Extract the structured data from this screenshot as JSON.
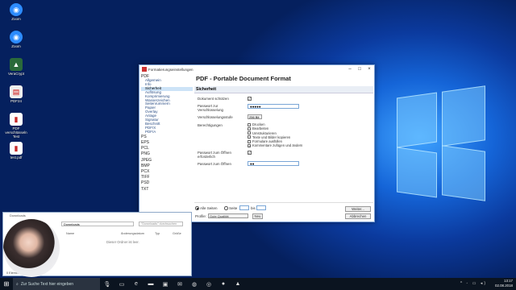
{
  "desktop": {
    "icons": [
      {
        "label": "Zoom",
        "glyph": "◉",
        "color": "#2d8cff",
        "icon": "zoom-icon"
      },
      {
        "label": "Zoom",
        "glyph": "◉",
        "color": "#2d8cff",
        "icon": "zoom-icon"
      },
      {
        "label": "VeraCrypt",
        "glyph": "▲",
        "color": "#2a6a3a",
        "icon": "veracrypt-icon"
      },
      {
        "label": "PDF24",
        "glyph": "▤",
        "color": "#eeeeee",
        "icon": "pdf24-icon"
      },
      {
        "label": "PDF verschlüsseln Test",
        "glyph": "▮",
        "color": "#c62828",
        "icon": "pdf-file-icon"
      },
      {
        "label": "test.pdf",
        "glyph": "▮",
        "color": "#c62828",
        "icon": "pdf-file-icon"
      }
    ]
  },
  "dialog": {
    "title": "Formatierungseinstellungen",
    "heading": "PDF - Portable Document Format",
    "section": "Sicherheit",
    "nav_pdf": "PDF",
    "nav_pdf_sub": [
      "Allgemein",
      "Info",
      "Sicherheit",
      "Auflösung",
      "Komprimierung",
      "Wasserzeichen",
      "Seitenrummern",
      "Papier",
      "Overlay",
      "Anlage",
      "Signatur",
      "Beschnitt",
      "PDF/X",
      "PDF/A"
    ],
    "nav_formats": [
      "PS",
      "EPS",
      "PCL",
      "PNG",
      "JPEG",
      "BMP",
      "PCX",
      "TIFF",
      "PSD",
      "TXT"
    ],
    "fields": {
      "protect_label": "Dokument schützen",
      "protect_checked": "✓",
      "pw_label": "Passwort zur Verschlüsselung",
      "pw_value": "●●●●●",
      "strength_label": "Verschlüsselungsstufe",
      "strength_value": "256 Bit",
      "perms_label": "Berechtigungen",
      "open_req_label": "Passwort zum Öffnen erforderlich",
      "open_req_checked": "✓",
      "open_pw_label": "Passwort zum Öffnen",
      "open_pw_value": "●●"
    },
    "permissions": [
      {
        "label": "Drucken",
        "checked": ""
      },
      {
        "label": "Bearbeiten",
        "checked": ""
      },
      {
        "label": "Umstrukturieren",
        "checked": ""
      },
      {
        "label": "Texte und Bilder kopieren",
        "checked": ""
      },
      {
        "label": "Formulare ausfüllen",
        "checked": ""
      },
      {
        "label": "Kommentare zufügen und ändern",
        "checked": "✓"
      }
    ],
    "bottom": {
      "all_pages": "Alle Seiten",
      "page": "Seite",
      "to": "bis",
      "profile_label": "Profile:",
      "profile_value": "Gute Qualität",
      "new_button": "Neu",
      "continue_button": "Weiter...",
      "cancel_button": "Abbrechen"
    }
  },
  "explorer": {
    "title": "Downloads",
    "address": "Downloads",
    "search_placeholder": "\"Downloads\" durchsuchen",
    "columns": [
      "Name",
      "Änderungsdatum",
      "Typ",
      "Größe"
    ],
    "empty_text": "Dieser Ordner ist leer.",
    "status": "0 Elemente"
  },
  "taskbar": {
    "search_placeholder": "Zur Suche Text hier eingeben",
    "time": "13:17",
    "date": "02.08.2018"
  }
}
